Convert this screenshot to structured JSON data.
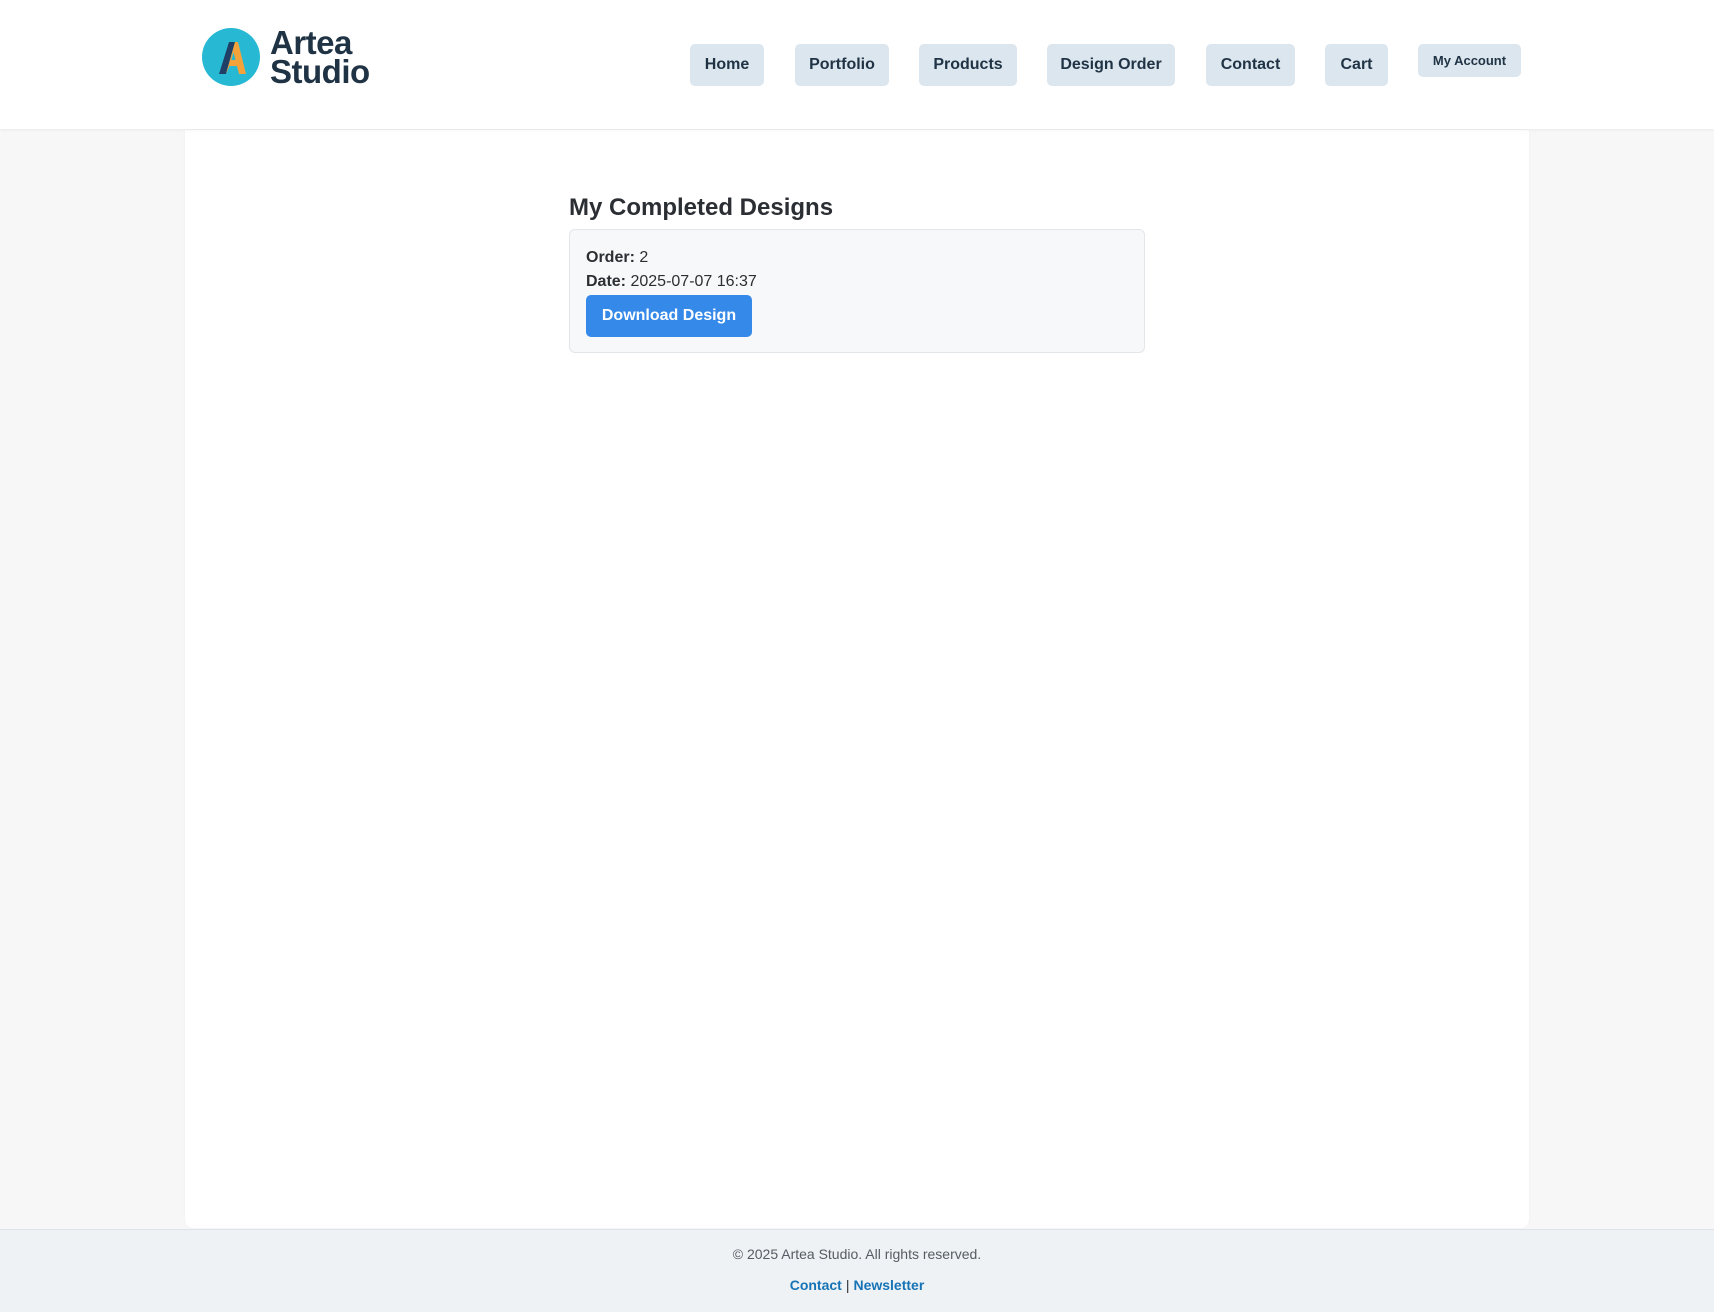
{
  "brand": {
    "name_line1": "Artea",
    "name_line2": "Studio",
    "colors": {
      "circle": "#27b9d4",
      "letter_main": "#f4a23a",
      "letter_shade": "#1f3f66",
      "text": "#1f3345"
    }
  },
  "nav": {
    "items": [
      {
        "label": "Home"
      },
      {
        "label": "Portfolio"
      },
      {
        "label": "Products"
      },
      {
        "label": "Design Order"
      },
      {
        "label": "Contact"
      },
      {
        "label": "Cart"
      },
      {
        "label": "My Account"
      }
    ]
  },
  "main": {
    "title": "My Completed Designs",
    "designs": [
      {
        "order_label": "Order:",
        "order_value": "2",
        "date_label": "Date:",
        "date_value": "2025-07-07 16:37",
        "button_label": "Download Design"
      }
    ]
  },
  "footer": {
    "copyright": "© 2025 Artea Studio. All rights reserved.",
    "links": [
      {
        "label": "Contact"
      },
      {
        "label": "Newsletter"
      }
    ],
    "separator": "|"
  },
  "colors": {
    "accent": "#3589e8",
    "nav_bg": "#dce6ee",
    "footer_link": "#1673b6",
    "page_bg": "#f7f7f7",
    "footer_bg": "#eef2f5"
  }
}
